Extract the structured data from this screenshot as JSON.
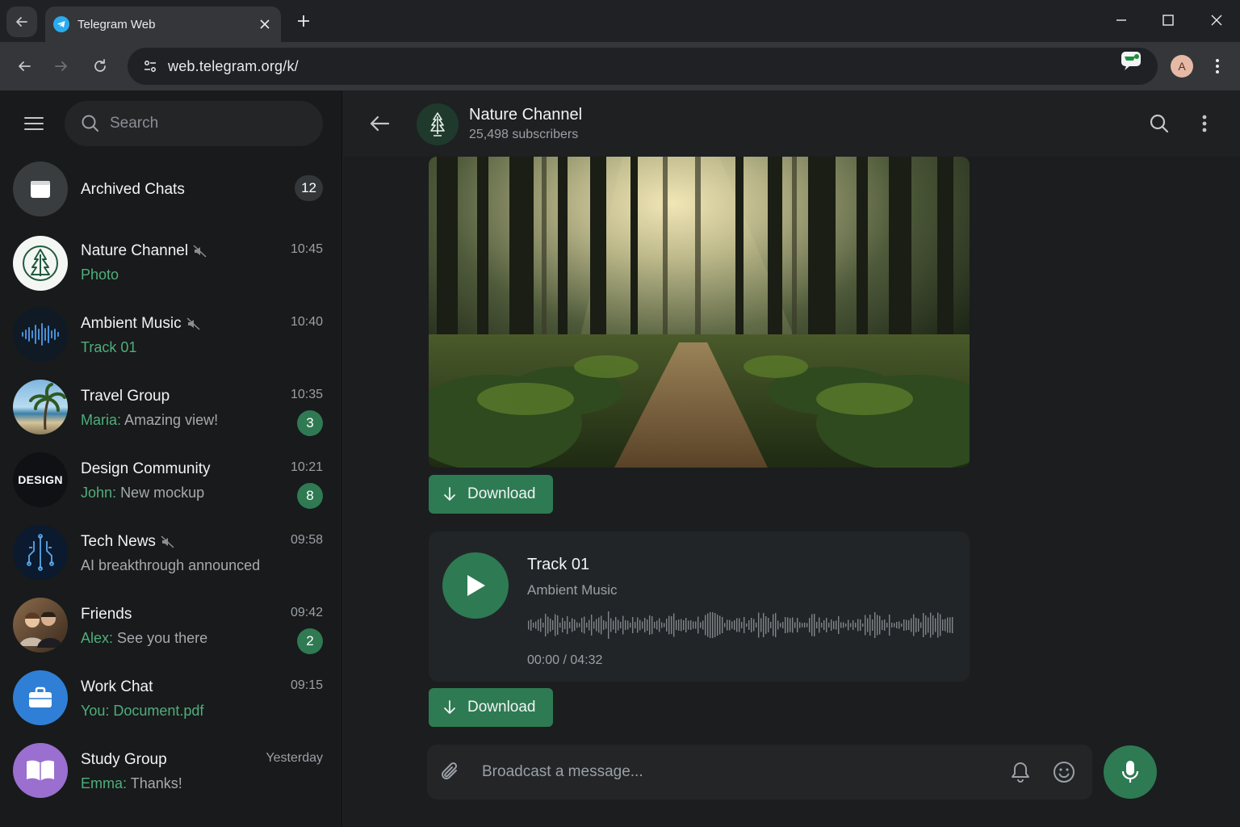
{
  "browser": {
    "tab_title": "Telegram Web",
    "url": "web.telegram.org/k/",
    "profile_initial": "A"
  },
  "sidebar": {
    "search_placeholder": "Search",
    "archived": {
      "label": "Archived Chats",
      "count": "12"
    },
    "chats": [
      {
        "name": "Nature Channel",
        "muted": true,
        "time": "10:45",
        "sender": "",
        "preview": "Photo",
        "preview_style": "green",
        "badge": ""
      },
      {
        "name": "Ambient Music",
        "muted": true,
        "time": "10:40",
        "sender": "",
        "preview": "Track 01",
        "preview_style": "green",
        "badge": ""
      },
      {
        "name": "Travel Group",
        "muted": false,
        "time": "10:35",
        "sender": "Maria:",
        "preview": "Amazing view!",
        "preview_style": "normal",
        "badge": "3"
      },
      {
        "name": "Design Community",
        "muted": false,
        "time": "10:21",
        "sender": "John:",
        "preview": "New mockup",
        "preview_style": "normal",
        "badge": "8",
        "avatar_text": "DESIGN"
      },
      {
        "name": "Tech News",
        "muted": true,
        "time": "09:58",
        "sender": "",
        "preview": "AI breakthrough announced",
        "preview_style": "normal",
        "badge": ""
      },
      {
        "name": "Friends",
        "muted": false,
        "time": "09:42",
        "sender": "Alex:",
        "preview": "See you there",
        "preview_style": "normal",
        "badge": "2"
      },
      {
        "name": "Work Chat",
        "muted": false,
        "time": "09:15",
        "sender": "",
        "preview": "You: Document.pdf",
        "preview_style": "green",
        "badge": ""
      },
      {
        "name": "Study Group",
        "muted": false,
        "time": "Yesterday",
        "sender": "Emma:",
        "preview": "Thanks!",
        "preview_style": "normal",
        "badge": ""
      }
    ]
  },
  "chat": {
    "title": "Nature Channel",
    "subtitle": "25,498 subscribers",
    "download_label": "Download",
    "audio": {
      "title": "Track 01",
      "artist": "Ambient Music",
      "time": "00:00 / 04:32"
    },
    "composer_placeholder": "Broadcast a message..."
  },
  "colors": {
    "accent": "#2e7a53",
    "accent_text": "#4fae7c",
    "sidebar_bg": "#181a1b",
    "main_bg": "#1b1d1f"
  }
}
